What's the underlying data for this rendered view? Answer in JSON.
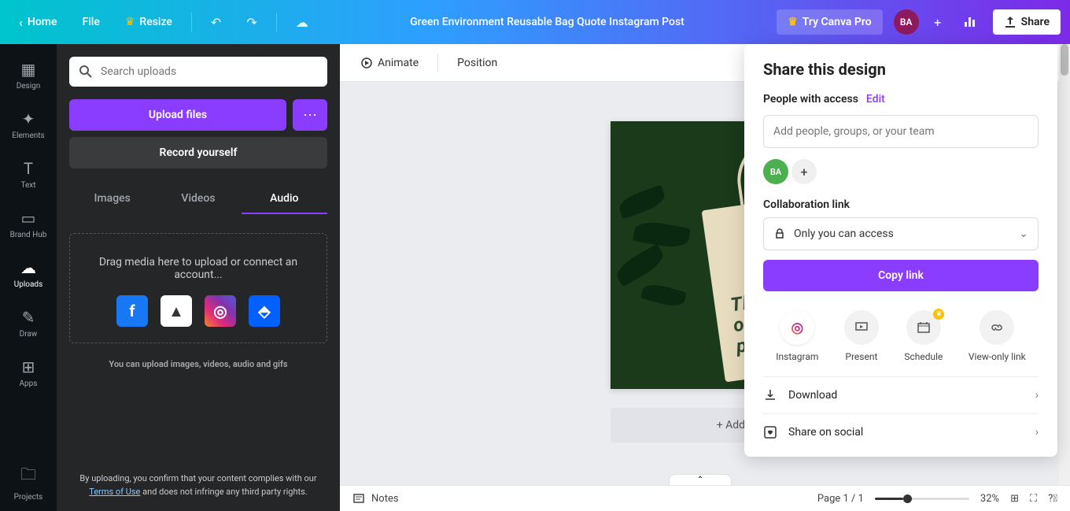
{
  "topbar": {
    "home": "Home",
    "file": "File",
    "resize": "Resize",
    "title": "Green Environment Reusable Bag Quote Instagram Post",
    "try_pro": "Try Canva Pro",
    "avatar": "BA",
    "share": "Share"
  },
  "leftnav": {
    "design": "Design",
    "elements": "Elements",
    "text": "Text",
    "brandhub": "Brand Hub",
    "uploads": "Uploads",
    "draw": "Draw",
    "apps": "Apps",
    "projects": "Projects"
  },
  "sidepanel": {
    "search_placeholder": "Search uploads",
    "upload_files": "Upload files",
    "record": "Record yourself",
    "tabs": {
      "images": "Images",
      "videos": "Videos",
      "audio": "Audio"
    },
    "dropzone": "Drag media here to upload or connect an account...",
    "note": "You can upload images, videos, audio and gifs",
    "footer1": "By uploading, you confirm that your content complies with our",
    "footer_link": "Terms of Use",
    "footer2": " and does not infringe any third party rights."
  },
  "canvas": {
    "animate": "Animate",
    "position": "Position",
    "bag_line1": "Think",
    "bag_line2": "of the",
    "bag_line3": "planet.",
    "add_page": "+ Add page"
  },
  "bottombar": {
    "notes": "Notes",
    "page": "Page 1 / 1",
    "zoom": "32%"
  },
  "share": {
    "title": "Share this design",
    "people_label": "People with access",
    "edit": "Edit",
    "input_placeholder": "Add people, groups, or your team",
    "avatar": "BA",
    "collab_label": "Collaboration link",
    "access": "Only you can access",
    "copy": "Copy link",
    "options": {
      "instagram": "Instagram",
      "present": "Present",
      "schedule": "Schedule",
      "viewonly": "View-only link"
    },
    "download": "Download",
    "social": "Share on social"
  }
}
